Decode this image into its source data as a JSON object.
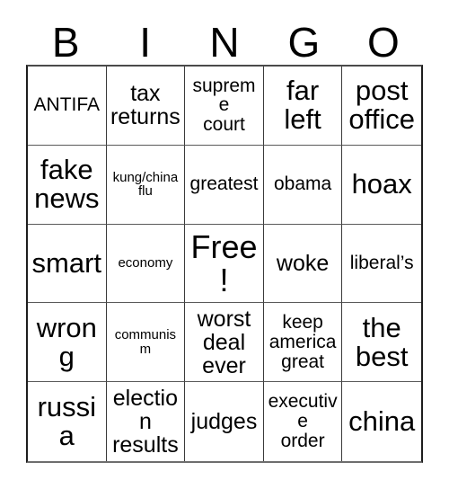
{
  "card": {
    "title_letters": [
      "B",
      "I",
      "N",
      "G",
      "O"
    ],
    "rows": [
      [
        {
          "text": "ANTIFA",
          "size": "s-sm"
        },
        {
          "text": "tax\nreturns",
          "size": "s-md"
        },
        {
          "text": "supreme\ncourt",
          "size": "s-sm"
        },
        {
          "text": "far\nleft",
          "size": "s-lg"
        },
        {
          "text": "post\noffice",
          "size": "s-lg"
        }
      ],
      [
        {
          "text": "fake\nnews",
          "size": "s-lg"
        },
        {
          "text": "kung/china\nflu",
          "size": "s-xs"
        },
        {
          "text": "greatest",
          "size": "s-sm"
        },
        {
          "text": "obama",
          "size": "s-sm"
        },
        {
          "text": "hoax",
          "size": "s-lg"
        }
      ],
      [
        {
          "text": "smart",
          "size": "s-lg"
        },
        {
          "text": "economy",
          "size": "s-xs"
        },
        {
          "text": "Free!",
          "size": "s-xl"
        },
        {
          "text": "woke",
          "size": "s-md"
        },
        {
          "text": "liberal’s",
          "size": "s-sm"
        }
      ],
      [
        {
          "text": "wrong",
          "size": "s-lg"
        },
        {
          "text": "communism",
          "size": "s-xs"
        },
        {
          "text": "worst\ndeal\never",
          "size": "s-md"
        },
        {
          "text": "keep\namerica\ngreat",
          "size": "s-sm"
        },
        {
          "text": "the\nbest",
          "size": "s-lg"
        }
      ],
      [
        {
          "text": "russia",
          "size": "s-lg"
        },
        {
          "text": "election\nresults",
          "size": "s-md"
        },
        {
          "text": "judges",
          "size": "s-md"
        },
        {
          "text": "executive\norder",
          "size": "s-sm"
        },
        {
          "text": "china",
          "size": "s-lg"
        }
      ]
    ],
    "colors": {
      "text": "#000000",
      "background": "#ffffff",
      "grid_line": "#3a3a3a"
    }
  }
}
